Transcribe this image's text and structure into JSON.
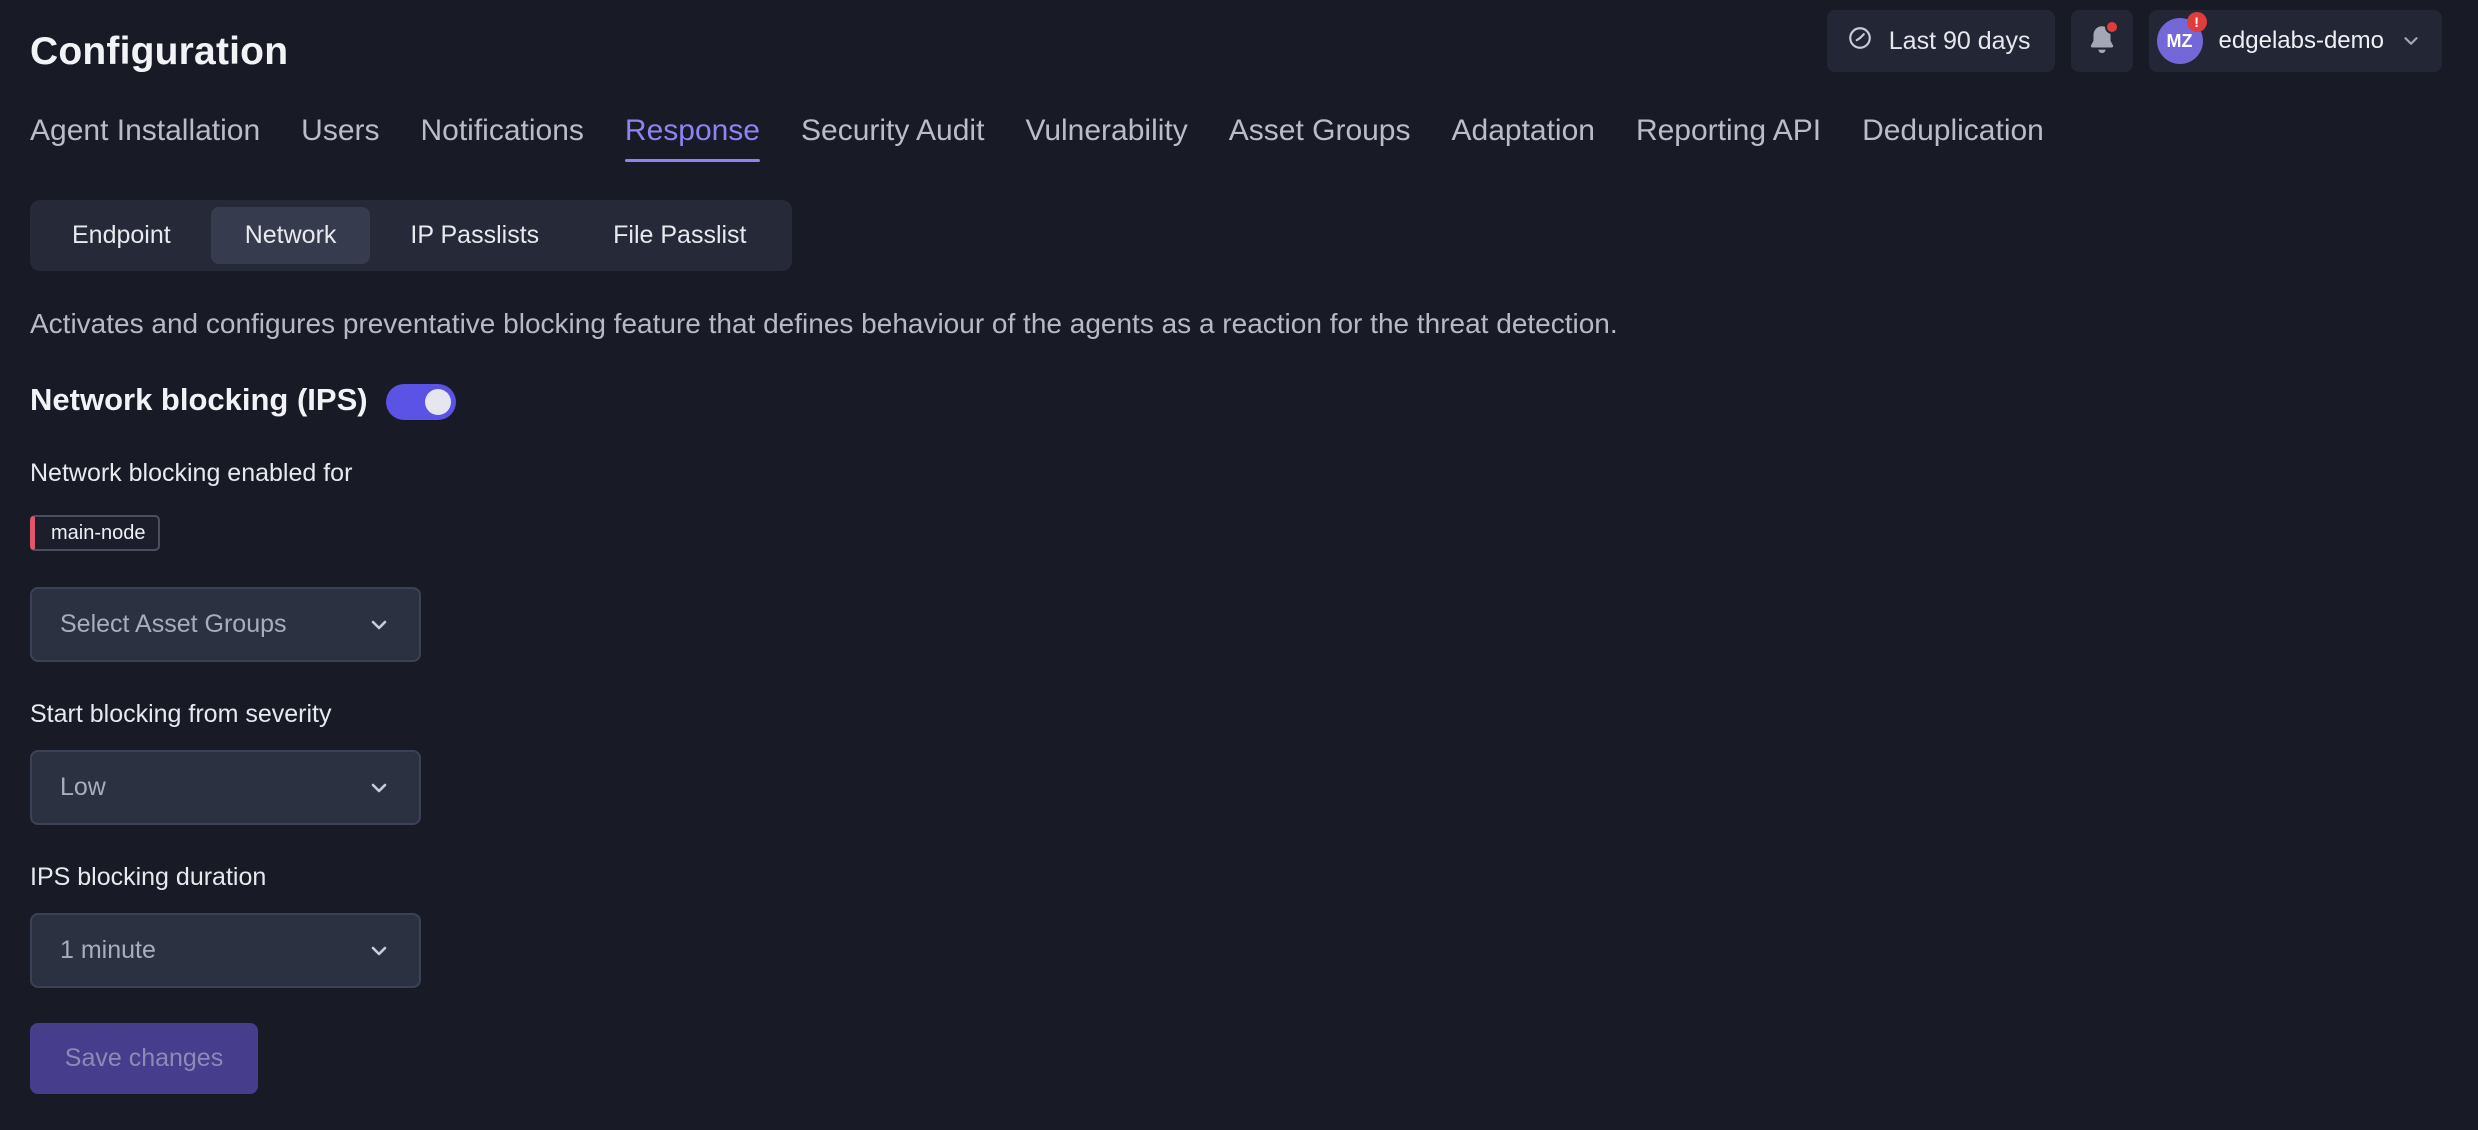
{
  "page": {
    "title": "Configuration"
  },
  "header": {
    "date_range_label": "Last 90 days",
    "account": {
      "initials": "MZ",
      "alert": "!",
      "name": "edgelabs-demo"
    }
  },
  "tabs": [
    {
      "label": "Agent Installation"
    },
    {
      "label": "Users"
    },
    {
      "label": "Notifications"
    },
    {
      "label": "Response",
      "active": true
    },
    {
      "label": "Security Audit"
    },
    {
      "label": "Vulnerability"
    },
    {
      "label": "Asset Groups"
    },
    {
      "label": "Adaptation"
    },
    {
      "label": "Reporting API"
    },
    {
      "label": "Deduplication"
    }
  ],
  "subtabs": [
    {
      "label": "Endpoint"
    },
    {
      "label": "Network",
      "active": true
    },
    {
      "label": "IP Passlists"
    },
    {
      "label": "File Passlist"
    }
  ],
  "content": {
    "description": "Activates and configures preventative blocking feature that defines behaviour of the agents as a reaction for the threat detection.",
    "section_title": "Network blocking (IPS)",
    "toggle_on": true,
    "enabled_for_label": "Network blocking enabled for",
    "enabled_for_chip": "main-node",
    "asset_groups_placeholder": "Select Asset Groups",
    "severity_label": "Start blocking from severity",
    "severity_value": "Low",
    "duration_label": "IPS blocking duration",
    "duration_value": "1 minute",
    "save_label": "Save changes"
  },
  "colors": {
    "background": "#181a25",
    "accent": "#8e83f4",
    "toggle": "#5b52e6",
    "chip_marker": "#e2566c",
    "alert": "#e03c3c"
  },
  "icons": {
    "date_range": "clock-icon",
    "notifications": "bell-icon",
    "dropdown": "chevron-down-icon"
  }
}
